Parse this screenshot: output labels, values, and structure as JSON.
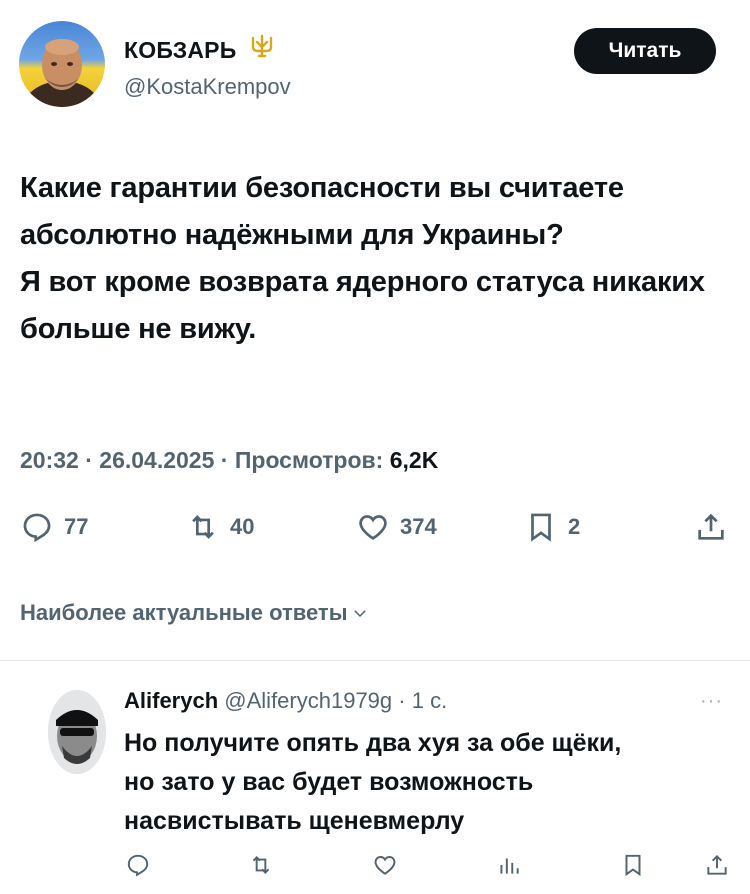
{
  "tweet": {
    "author_name": "КОБЗАРЬ",
    "author_badge_icon": "trident-icon",
    "handle": "@KostaKrempov",
    "follow_label": "Читать",
    "text_lines": [
      "Какие гарантии безопасности вы считаете абсолютно надёжными для Украины?",
      "Я вот кроме возврата ядерного статуса никаких больше не вижу."
    ],
    "time": "20:32",
    "date": "26.04.2025",
    "views_label": "Просмотров:",
    "views_count": "6,2K",
    "separator": "·"
  },
  "actions": {
    "replies": "77",
    "reposts": "40",
    "likes": "374",
    "bookmarks": "2"
  },
  "replies_sort": {
    "label": "Наиболее актуальные ответы"
  },
  "reply": {
    "author_name": "Aliferych",
    "handle": "@Aliferych1979g",
    "time": "1 с.",
    "more": "···",
    "text_lines": [
      "Но получите опять два хуя за обе щёки,",
      "но зато у вас будет  возможность",
      "насвистывать щеневмерлу"
    ]
  },
  "colors": {
    "text": "#0f1419",
    "secondary": "#536471",
    "button_bg": "#0f1419",
    "badge": "#d9a818"
  }
}
